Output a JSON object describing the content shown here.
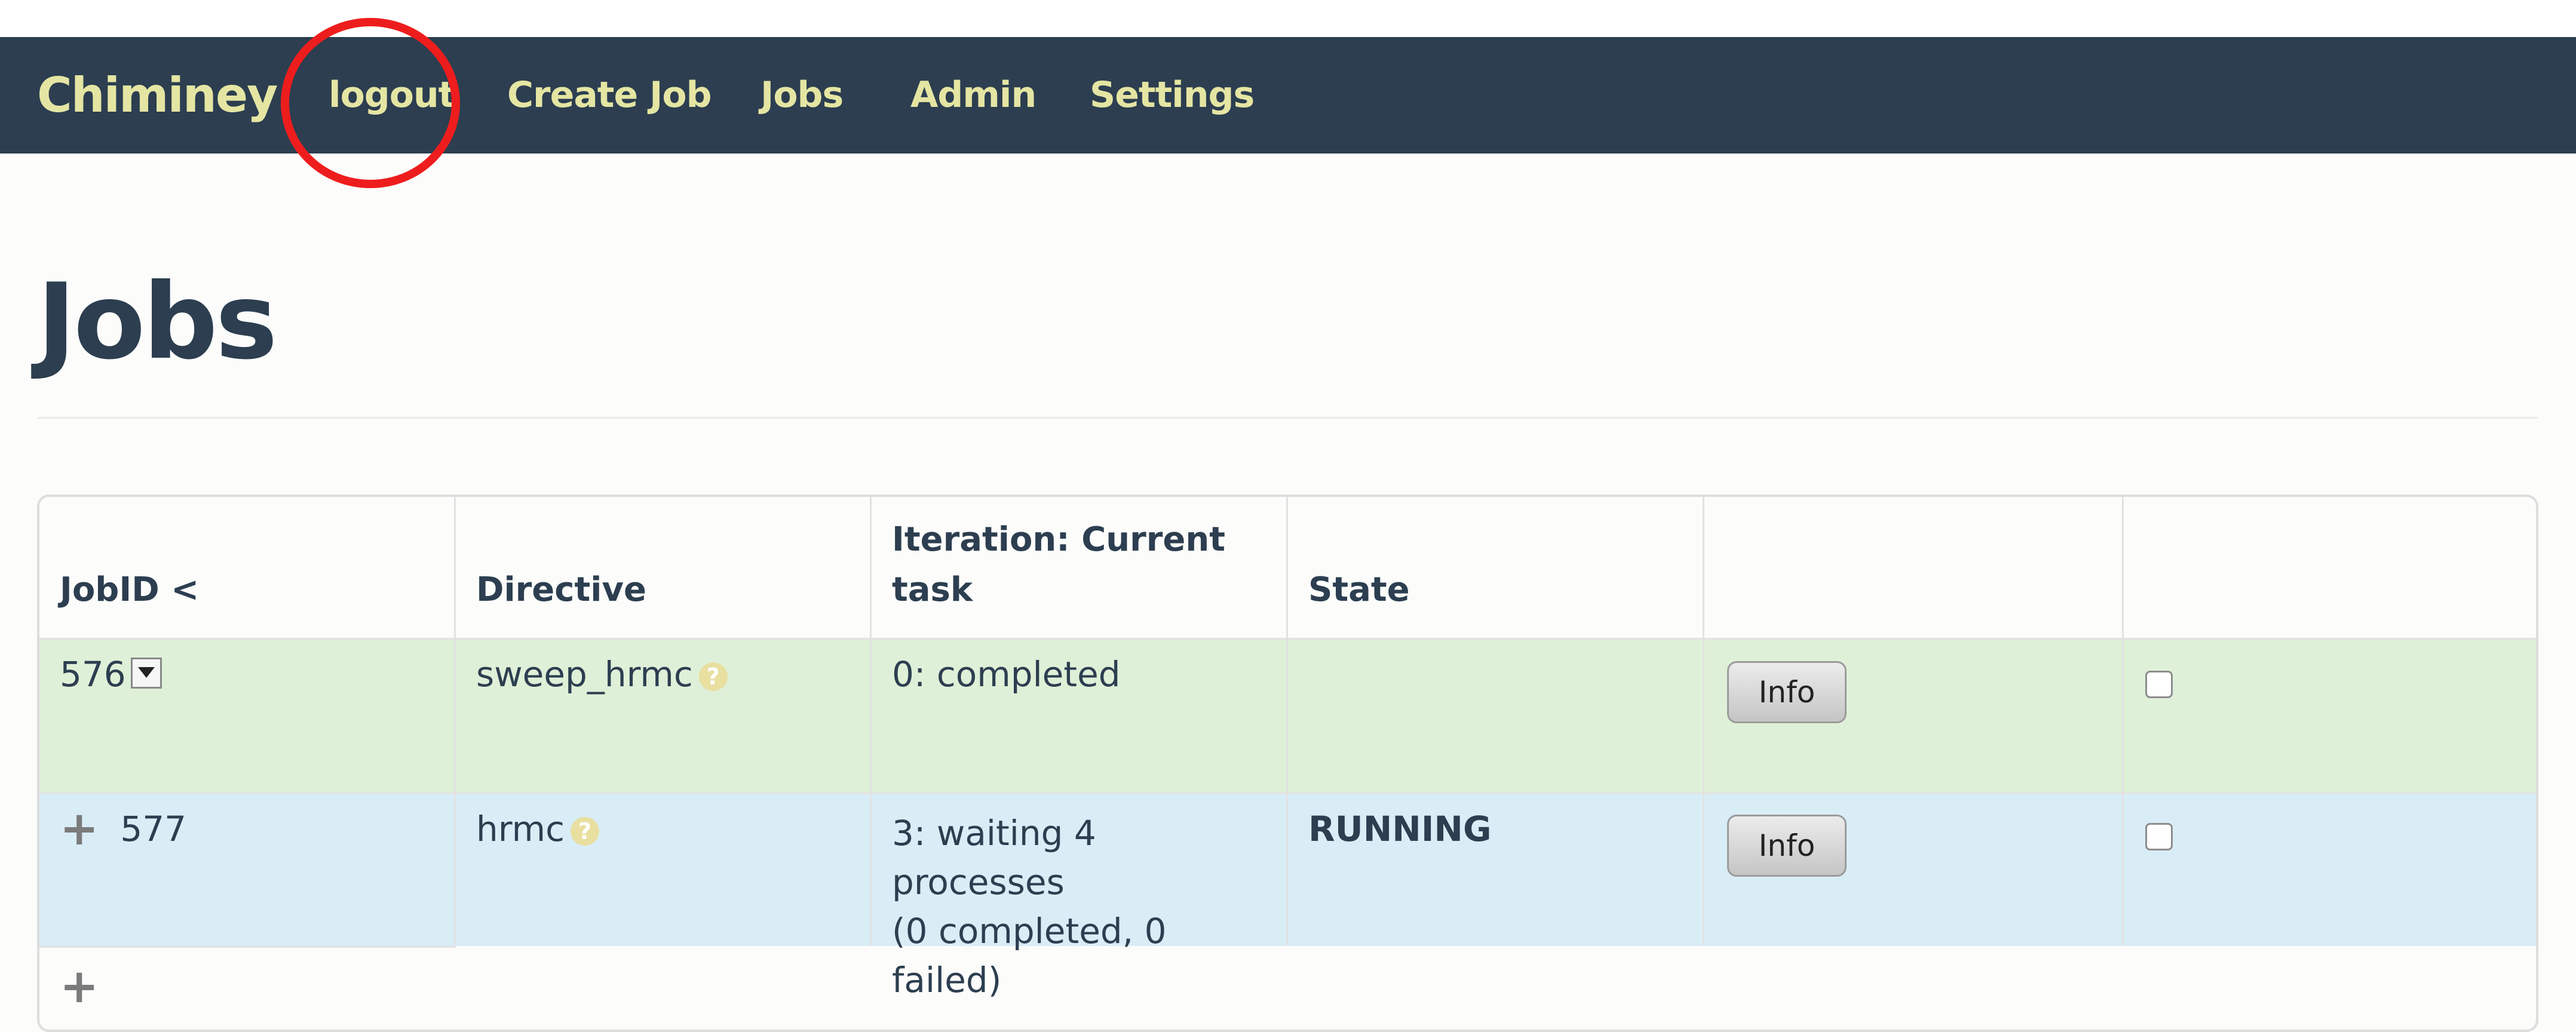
{
  "nav": {
    "brand": "Chiminey",
    "links": [
      "logout",
      "Create Job",
      "Jobs",
      "Admin",
      "Settings"
    ]
  },
  "page": {
    "title": "Jobs"
  },
  "table": {
    "headers": [
      "JobID <",
      "Directive",
      "Iteration: Current task",
      "State",
      "",
      ""
    ],
    "rows": [
      {
        "job_id": "576",
        "directive": "sweep_hrmc",
        "iteration": "0: completed",
        "iteration_line2": "",
        "state": "",
        "info_label": "Info"
      },
      {
        "job_id": "577",
        "directive": "hrmc",
        "iteration": "3: waiting 4 processes",
        "iteration_line2": "(0 completed, 0 failed)",
        "state": "RUNNING",
        "info_label": "Info"
      }
    ]
  },
  "icons": {
    "help": "question-circle-icon",
    "dropdown": "chevron-down-icon",
    "expand": "plus-icon"
  },
  "colors": {
    "navbar": "#2c3e50",
    "nav_text": "#e5e5a3",
    "row_success": "#dff0d8",
    "row_info": "#d9edf7",
    "annotation": "#ee1d1d"
  }
}
